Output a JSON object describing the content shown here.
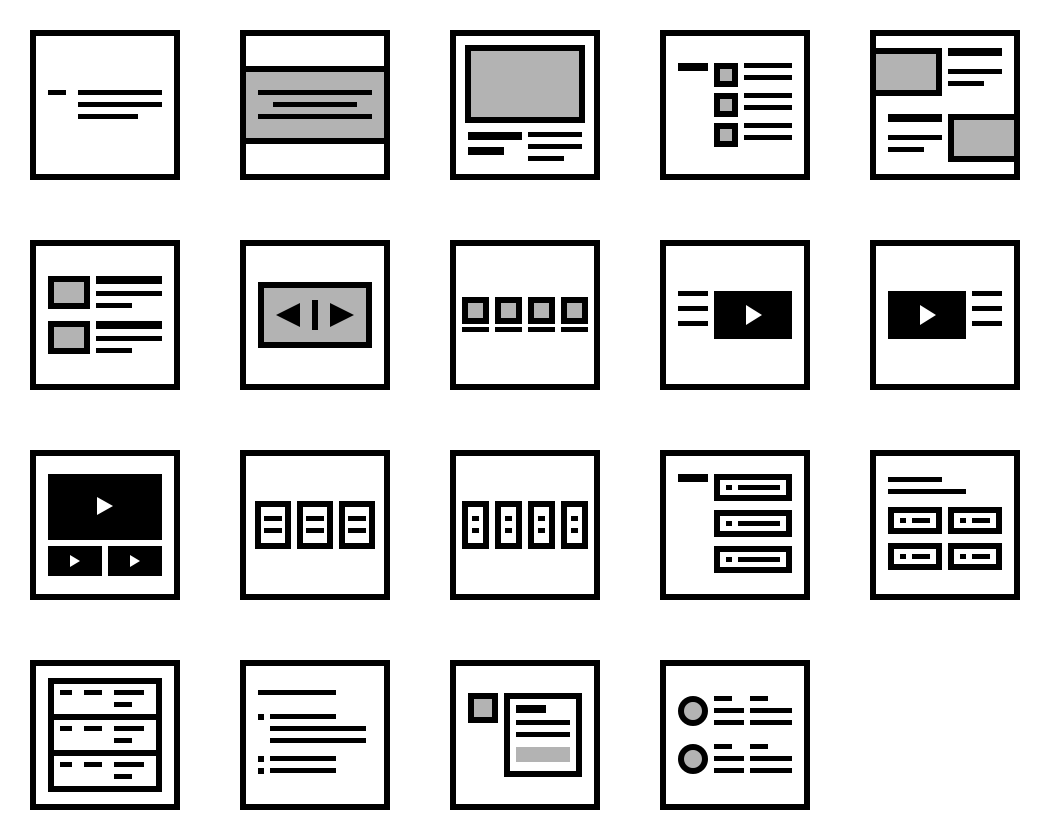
{
  "colors": {
    "ink": "#000000",
    "fill": "#b3b3b3",
    "paper": "#ffffff"
  },
  "tiles": [
    {
      "icon": "text-block-layout-icon"
    },
    {
      "icon": "banner-layout-icon"
    },
    {
      "icon": "large-image-with-text-layout-icon"
    },
    {
      "icon": "checklist-layout-icon"
    },
    {
      "icon": "alternating-image-text-layout-icon"
    },
    {
      "icon": "media-list-layout-icon"
    },
    {
      "icon": "image-slider-layout-icon"
    },
    {
      "icon": "gallery-row-layout-icon"
    },
    {
      "icon": "text-left-video-right-layout-icon"
    },
    {
      "icon": "video-left-text-right-layout-icon"
    },
    {
      "icon": "video-playlist-layout-icon"
    },
    {
      "icon": "three-column-cards-layout-icon"
    },
    {
      "icon": "four-column-cards-layout-icon"
    },
    {
      "icon": "form-fields-layout-icon"
    },
    {
      "icon": "button-grid-layout-icon"
    },
    {
      "icon": "table-rows-layout-icon"
    },
    {
      "icon": "bullet-list-layout-icon"
    },
    {
      "icon": "document-card-layout-icon"
    },
    {
      "icon": "profile-list-layout-icon"
    }
  ]
}
